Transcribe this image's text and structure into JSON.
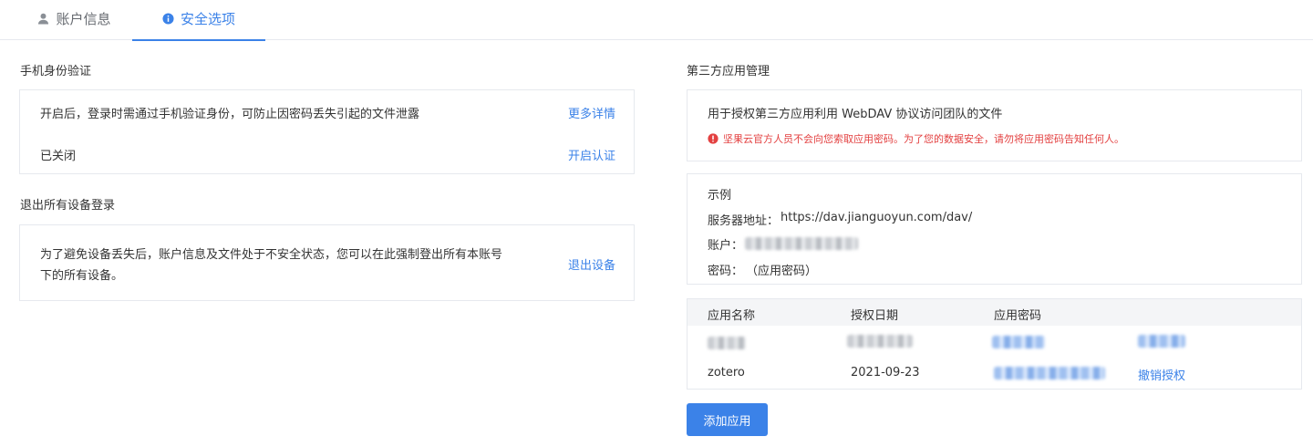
{
  "tabs": {
    "account": "账户信息",
    "security": "安全选项"
  },
  "phone_verify": {
    "title": "手机身份验证",
    "description": "开启后，登录时需通过手机验证身份，可防止因密码丢失引起的文件泄露",
    "more_link": "更多详情",
    "status": "已关闭",
    "enable_link": "开启认证"
  },
  "logout_all": {
    "title": "退出所有设备登录",
    "description_line1": "为了避免设备丢失后，账户信息及文件处于不安全状态，您可以在此强制登出所有本账号",
    "description_line2": "下的所有设备。",
    "logout_link": "退出设备"
  },
  "third_party": {
    "title": "第三方应用管理",
    "description": "用于授权第三方应用利用 WebDAV 协议访问团队的文件",
    "warning": "坚果云官方人员不会向您索取应用密码。为了您的数据安全，请勿将应用密码告知任何人。",
    "example": {
      "title": "示例",
      "server_label": "服务器地址：",
      "server_value": "https://dav.jianguoyun.com/dav/",
      "account_label": "账户：",
      "password_label": "密码：",
      "password_value": "（应用密码）"
    },
    "table": {
      "headers": [
        "应用名称",
        "授权日期",
        "应用密码"
      ],
      "rows": [
        {
          "name": "zotero",
          "date": "2021-09-23",
          "action": "撤销授权"
        }
      ]
    },
    "add_button": "添加应用"
  },
  "colors": {
    "accent": "#3b82e8",
    "warning": "#e34141",
    "border": "#e6e9ee"
  }
}
